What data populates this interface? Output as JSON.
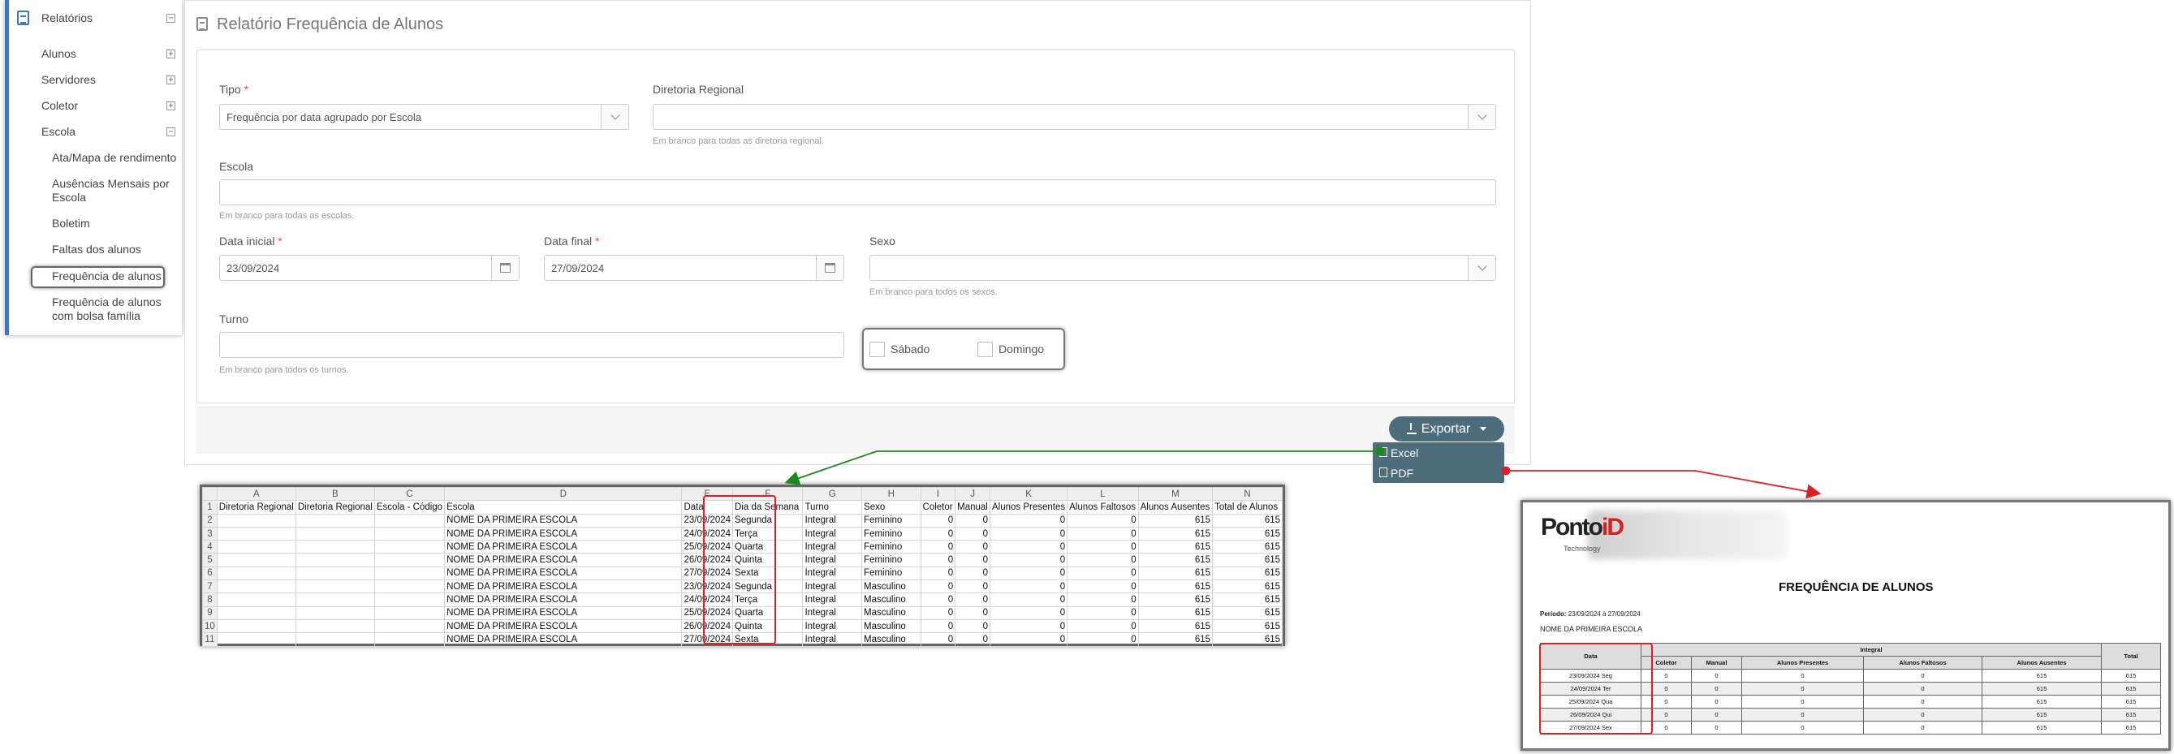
{
  "sidebar": {
    "title": "Relatórios",
    "items": [
      "Alunos",
      "Servidores",
      "Coletor",
      "Escola"
    ],
    "escola_subitems": [
      "Ata/Mapa de rendimento",
      "Ausências Mensais por Escola",
      "Boletim",
      "Faltas dos alunos",
      "Frequência de alunos",
      "Frequência de alunos com bolsa família"
    ],
    "selected": "Frequência de alunos"
  },
  "page": {
    "title": "Relatório Frequência de Alunos"
  },
  "form": {
    "tipo_label": "Tipo",
    "tipo_value": "Frequência por data agrupado por Escola",
    "diretoria_label": "Diretoria Regional",
    "diretoria_hint": "Em branco para todas as diretoria regional.",
    "escola_label": "Escola",
    "escola_hint": "Em branco para todas as escolas.",
    "data_inicial_label": "Data inicial",
    "data_inicial_value": "23/09/2024",
    "data_final_label": "Data final",
    "data_final_value": "27/09/2024",
    "sexo_label": "Sexo",
    "sexo_hint": "Em branco para todos os sexos.",
    "turno_label": "Turno",
    "turno_hint": "Em branco para todos os turnos.",
    "sabado_label": "Sábado",
    "domingo_label": "Domingo",
    "required_mark": "*"
  },
  "export": {
    "button_label": "Exportar",
    "options": [
      "Excel",
      "PDF"
    ]
  },
  "spreadsheet": {
    "col_letters": [
      "",
      "A",
      "B",
      "C",
      "D",
      "E",
      "F",
      "G",
      "H",
      "I",
      "J",
      "K",
      "L",
      "M",
      "N"
    ],
    "headers": [
      "Diretoria Regional",
      "Diretoria Regional",
      "Escola - Código",
      "Escola",
      "Data",
      "Dia da Semana",
      "Turno",
      "Sexo",
      "Coletor",
      "Manual",
      "Alunos Presentes",
      "Alunos Faltosos",
      "Alunos Ausentes",
      "Total de Alunos"
    ],
    "rows": [
      [
        "",
        "",
        "",
        "NOME DA PRIMEIRA ESCOLA",
        "23/09/2024",
        "Segunda",
        "Integral",
        "Feminino",
        "0",
        "0",
        "0",
        "0",
        "615",
        "615"
      ],
      [
        "",
        "",
        "",
        "NOME DA PRIMEIRA ESCOLA",
        "24/09/2024",
        "Terça",
        "Integral",
        "Feminino",
        "0",
        "0",
        "0",
        "0",
        "615",
        "615"
      ],
      [
        "",
        "",
        "",
        "NOME DA PRIMEIRA ESCOLA",
        "25/09/2024",
        "Quarta",
        "Integral",
        "Feminino",
        "0",
        "0",
        "0",
        "0",
        "615",
        "615"
      ],
      [
        "",
        "",
        "",
        "NOME DA PRIMEIRA ESCOLA",
        "26/09/2024",
        "Quinta",
        "Integral",
        "Feminino",
        "0",
        "0",
        "0",
        "0",
        "615",
        "615"
      ],
      [
        "",
        "",
        "",
        "NOME DA PRIMEIRA ESCOLA",
        "27/09/2024",
        "Sexta",
        "Integral",
        "Feminino",
        "0",
        "0",
        "0",
        "0",
        "615",
        "615"
      ],
      [
        "",
        "",
        "",
        "NOME DA PRIMEIRA ESCOLA",
        "23/09/2024",
        "Segunda",
        "Integral",
        "Masculino",
        "0",
        "0",
        "0",
        "0",
        "615",
        "615"
      ],
      [
        "",
        "",
        "",
        "NOME DA PRIMEIRA ESCOLA",
        "24/09/2024",
        "Terça",
        "Integral",
        "Masculino",
        "0",
        "0",
        "0",
        "0",
        "615",
        "615"
      ],
      [
        "",
        "",
        "",
        "NOME DA PRIMEIRA ESCOLA",
        "25/09/2024",
        "Quarta",
        "Integral",
        "Masculino",
        "0",
        "0",
        "0",
        "0",
        "615",
        "615"
      ],
      [
        "",
        "",
        "",
        "NOME DA PRIMEIRA ESCOLA",
        "26/09/2024",
        "Quinta",
        "Integral",
        "Masculino",
        "0",
        "0",
        "0",
        "0",
        "615",
        "615"
      ],
      [
        "",
        "",
        "",
        "NOME DA PRIMEIRA ESCOLA",
        "27/09/2024",
        "Sexta",
        "Integral",
        "Masculino",
        "0",
        "0",
        "0",
        "0",
        "615",
        "615"
      ]
    ]
  },
  "pdf": {
    "logo_main": "Ponto",
    "logo_id": "iD",
    "logo_sub": "Technology",
    "title": "FREQUÊNCIA DE ALUNOS",
    "period_label": "Período:",
    "period_value": "23/09/2024 à 27/09/2024",
    "school": "NOME DA PRIMEIRA ESCOLA",
    "header_data": "Data",
    "header_group": "Integral",
    "header_total": "Total",
    "subheaders": [
      "Coletor",
      "Manual",
      "Alunos Presentes",
      "Alunos Faltosos",
      "Alunos Ausentes"
    ],
    "rows": [
      [
        "23/09/2024 Seg",
        "0",
        "0",
        "0",
        "0",
        "615",
        "615"
      ],
      [
        "24/09/2024 Ter",
        "0",
        "0",
        "0",
        "0",
        "615",
        "615"
      ],
      [
        "25/09/2024 Qua",
        "0",
        "0",
        "0",
        "0",
        "615",
        "615"
      ],
      [
        "26/09/2024 Qui",
        "0",
        "0",
        "0",
        "0",
        "615",
        "615"
      ],
      [
        "27/09/2024 Sex",
        "0",
        "0",
        "0",
        "0",
        "615",
        "615"
      ]
    ]
  },
  "colors": {
    "accent": "#3c78c4",
    "export_btn": "#4d6d7d",
    "highlight_red": "#e02020",
    "arrow_green": "#1a8a1a"
  }
}
